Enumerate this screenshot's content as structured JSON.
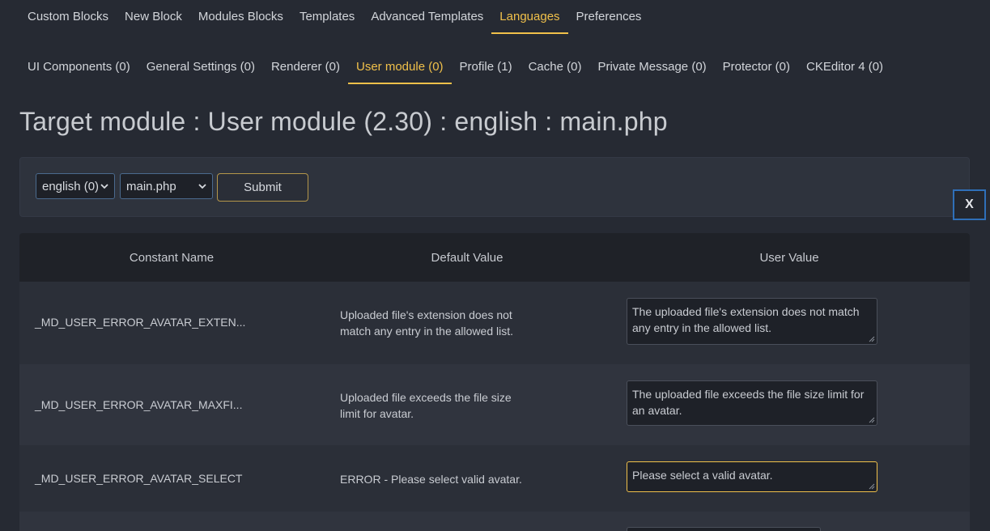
{
  "nav_top": {
    "items": [
      {
        "label": "Custom Blocks",
        "active": false
      },
      {
        "label": "New Block",
        "active": false
      },
      {
        "label": "Modules Blocks",
        "active": false
      },
      {
        "label": "Templates",
        "active": false
      },
      {
        "label": "Advanced Templates",
        "active": false
      },
      {
        "label": "Languages",
        "active": true
      },
      {
        "label": "Preferences",
        "active": false
      }
    ]
  },
  "nav_sub": {
    "items": [
      {
        "label": "UI Components (0)",
        "active": false
      },
      {
        "label": "General Settings (0)",
        "active": false
      },
      {
        "label": "Renderer (0)",
        "active": false
      },
      {
        "label": "User module (0)",
        "active": true
      },
      {
        "label": "Profile (1)",
        "active": false
      },
      {
        "label": "Cache (0)",
        "active": false
      },
      {
        "label": "Private Message (0)",
        "active": false
      },
      {
        "label": "Protector (0)",
        "active": false
      },
      {
        "label": "CKEditor 4 (0)",
        "active": false
      }
    ]
  },
  "page_title": "Target module : User module (2.30) : english : main.php",
  "filter": {
    "language_selected": "english (0)",
    "file_selected": "main.php",
    "submit_label": "Submit"
  },
  "close_label": "X",
  "table": {
    "headers": [
      "Constant Name",
      "Default Value",
      "User Value"
    ],
    "rows": [
      {
        "name": "_MD_USER_ERROR_AVATAR_EXTEN...",
        "default": "Uploaded file's extension does not match any entry in the allowed list.",
        "user": "The uploaded file's extension does not match any entry in the allowed list."
      },
      {
        "name": "_MD_USER_ERROR_AVATAR_MAXFI...",
        "default": "Uploaded file exceeds the file size limit for avatar.",
        "user": "The uploaded file exceeds the file size limit for an avatar."
      },
      {
        "name": "_MD_USER_ERROR_AVATAR_SELECT",
        "default": "ERROR - Please select valid avatar.",
        "user": "Please select a valid avatar."
      }
    ]
  },
  "colors": {
    "accent": "#f0c04a",
    "background": "#262a33",
    "focus_border": "#2f6fb8"
  },
  "icons": {
    "select_arrow": "chevron-down-icon",
    "textarea_resize": "resize-handle-icon"
  }
}
